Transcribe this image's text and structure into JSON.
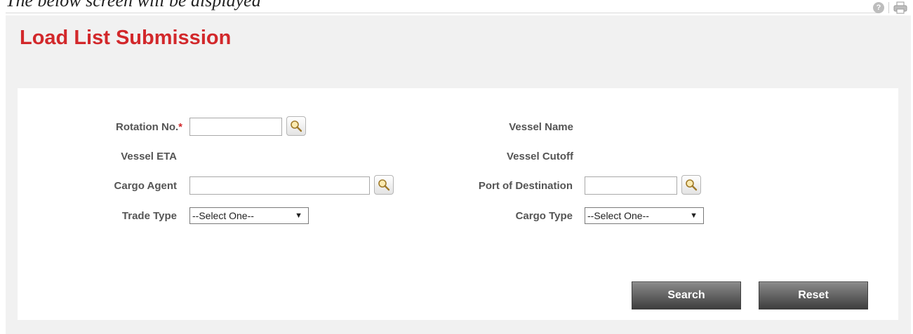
{
  "caption": "The below screen will be displayed",
  "page_title": "Load List Submission",
  "form": {
    "rotation_no": {
      "label": "Rotation No.",
      "required_mark": "*",
      "value": ""
    },
    "vessel_name": {
      "label": "Vessel Name"
    },
    "vessel_eta": {
      "label": "Vessel ETA"
    },
    "vessel_cutoff": {
      "label": "Vessel Cutoff"
    },
    "cargo_agent": {
      "label": "Cargo Agent",
      "value": ""
    },
    "port_of_destination": {
      "label": "Port of Destination",
      "value": ""
    },
    "trade_type": {
      "label": "Trade Type",
      "selected": "--Select One--"
    },
    "cargo_type": {
      "label": "Cargo Type",
      "selected": "--Select One--"
    }
  },
  "buttons": {
    "search": "Search",
    "reset": "Reset"
  },
  "icons": {
    "lookup": "magnifier-icon",
    "help": "help-icon",
    "print": "print-icon"
  },
  "colors": {
    "title": "#d2282b",
    "panel_bg": "#f1f1f1",
    "button_dark": "#3e3e3e"
  }
}
